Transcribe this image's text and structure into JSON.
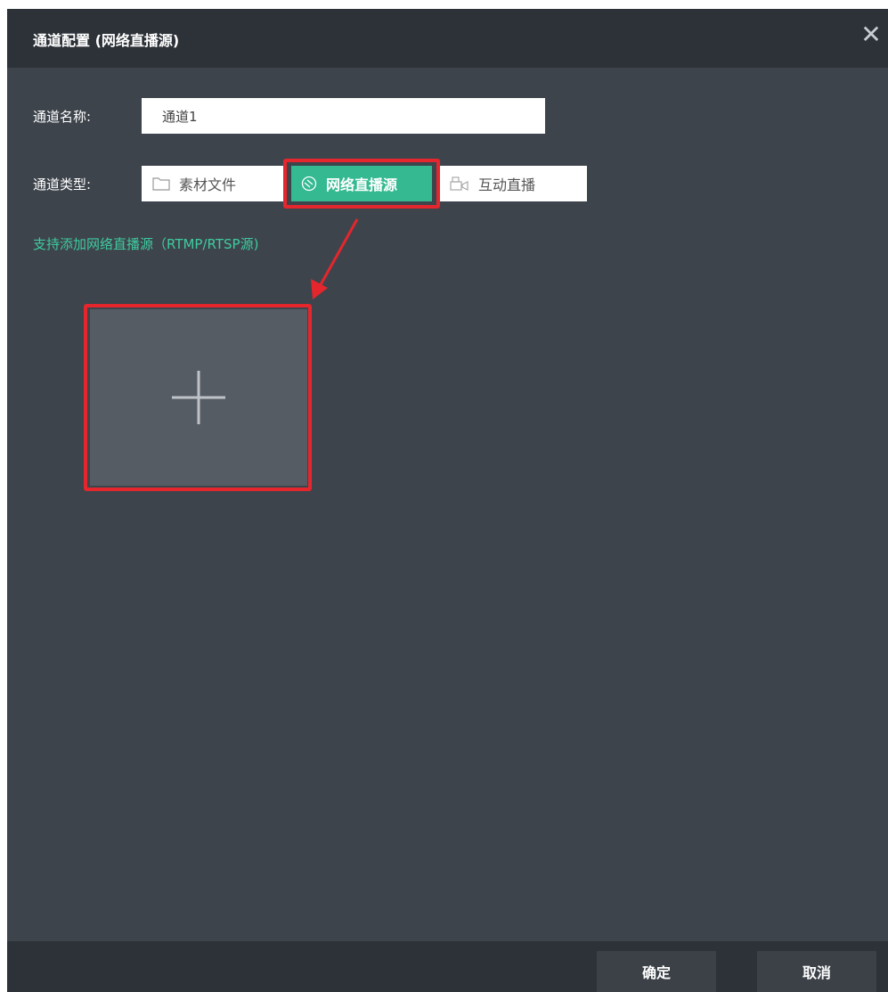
{
  "dialog": {
    "title": "通道配置 (网络直播源)",
    "close_icon": "close-icon"
  },
  "form": {
    "name_label": "通道名称:",
    "name_value": "通道1",
    "type_label": "通道类型:",
    "types": [
      {
        "label": "素材文件",
        "icon": "folder-icon",
        "selected": false
      },
      {
        "label": "网络直播源",
        "icon": "stream-icon",
        "selected": true
      },
      {
        "label": "互动直播",
        "icon": "camera-icon",
        "selected": false
      }
    ],
    "hint": "支持添加网络直播源（RTMP/RTSP源)"
  },
  "add_tile": {
    "icon": "plus-icon"
  },
  "footer": {
    "ok_label": "确定",
    "cancel_label": "取消"
  },
  "colors": {
    "accent": "#34b990",
    "hint": "#3ecba0",
    "annotation": "#e5262d",
    "dialog_bg": "#3e444c",
    "titlebar_bg": "#2d3238"
  }
}
